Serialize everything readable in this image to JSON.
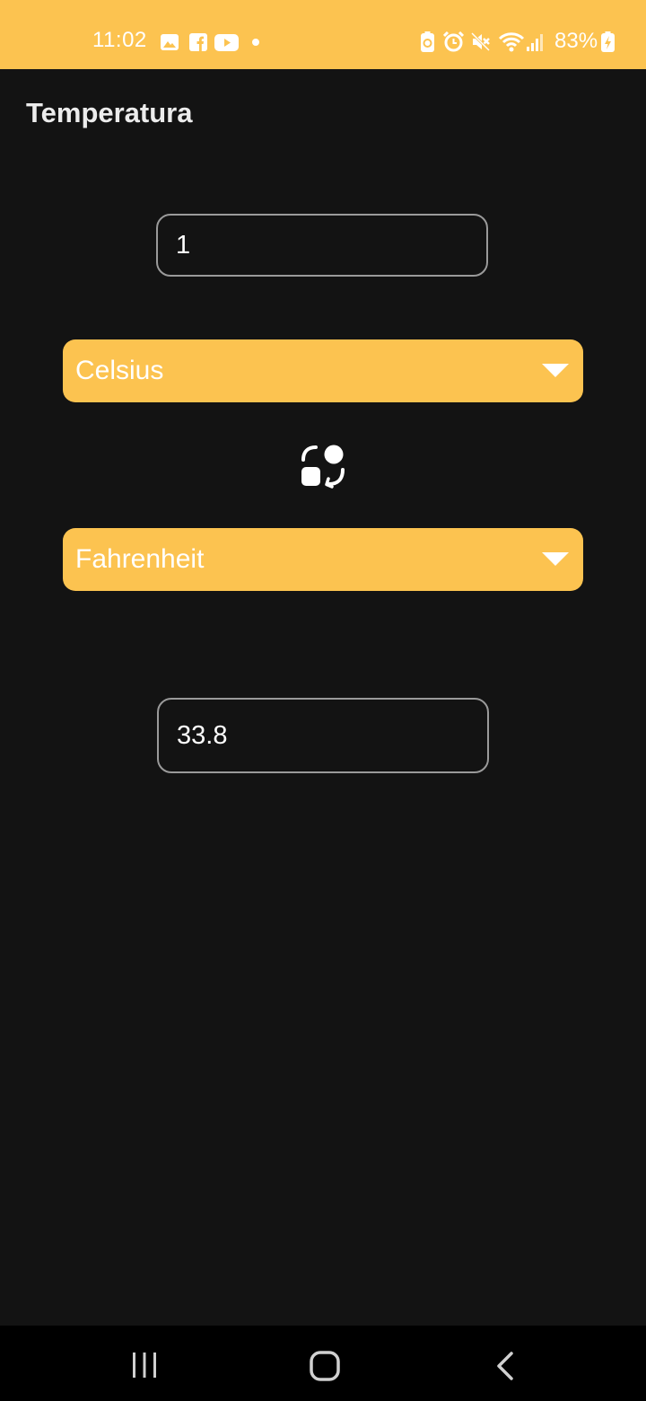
{
  "status_bar": {
    "time": "11:02",
    "battery_percent": "83%",
    "background_color": "#FCC350",
    "left_icons": [
      "gallery-icon",
      "facebook-icon",
      "youtube-icon",
      "notification-dot-icon"
    ],
    "right_icons": [
      "battery-saver-icon",
      "alarm-icon",
      "mute-icon",
      "wifi-icon",
      "signal-icon",
      "battery-charging-icon"
    ]
  },
  "page": {
    "title": "Temperatura",
    "background_color": "#131313",
    "accent_color": "#FCC350"
  },
  "converter": {
    "input_value": "1",
    "from_unit": "Celsius",
    "to_unit": "Fahrenheit",
    "result_value": "33.8",
    "swap_icon": "swap-units-icon"
  },
  "nav_bar": {
    "buttons": [
      "recents-icon",
      "home-icon",
      "back-icon"
    ]
  }
}
